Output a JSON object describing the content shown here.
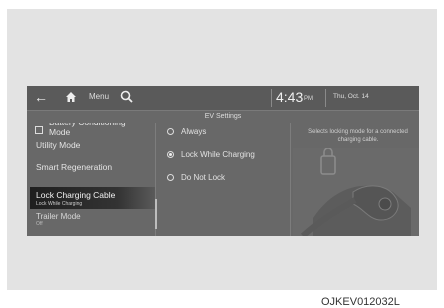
{
  "topbar": {
    "back_icon": "back-arrow-icon",
    "home_icon": "home-icon",
    "menu_label": "Menu",
    "search_icon": "search-icon",
    "time": "4:43",
    "ampm": "PM",
    "date": "Thu, Oct. 14"
  },
  "screen_title": "EV Settings",
  "menu": {
    "items": [
      {
        "label": "Battery Conditioning Mode"
      },
      {
        "label": "Utility Mode"
      },
      {
        "label": "Smart Regeneration"
      },
      {
        "label": "Lock Charging Cable",
        "sub": "Lock While Charging",
        "selected": true
      },
      {
        "label": "Trailer Mode",
        "sub": "Off"
      }
    ]
  },
  "options": [
    {
      "label": "Always",
      "selected": false
    },
    {
      "label": "Lock While Charging",
      "selected": true
    },
    {
      "label": "Do Not Lock",
      "selected": false
    }
  ],
  "description": "Selects locking mode for a connected charging cable.",
  "caption": "OJKEV012032L"
}
